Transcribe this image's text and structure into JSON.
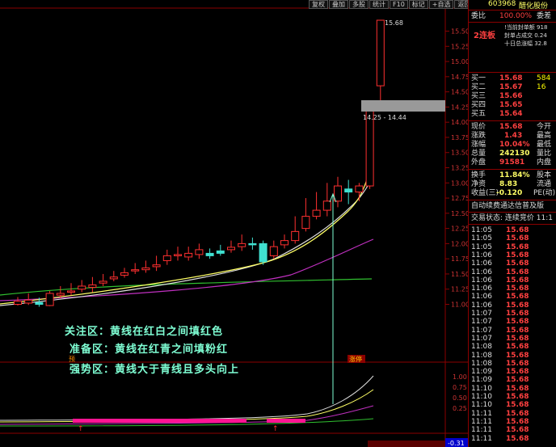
{
  "toolbar": [
    "复权",
    "叠加",
    "多股",
    "统计",
    "F10",
    "标记",
    "+自选",
    "返回"
  ],
  "stock": {
    "code": "603968",
    "name": "醋化股份"
  },
  "weibi": {
    "label": "委比",
    "value": "100.00%",
    "label2": "委差"
  },
  "lianban": "2连板",
  "limitup_info": [
    "!当前封单额 918",
    "封单占成交 0.24",
    "十日总涨幅 32.8"
  ],
  "bids": [
    {
      "label": "买一",
      "price": "15.68",
      "vol": "584"
    },
    {
      "label": "买二",
      "price": "15.67",
      "vol": "16"
    },
    {
      "label": "买三",
      "price": "15.66",
      "vol": ""
    },
    {
      "label": "买四",
      "price": "15.65",
      "vol": ""
    },
    {
      "label": "买五",
      "price": "15.64",
      "vol": ""
    }
  ],
  "quote": [
    {
      "l": "现价",
      "v": "15.68",
      "r": "今开"
    },
    {
      "l": "涨跌",
      "v": "1.43",
      "r": "最高"
    },
    {
      "l": "涨幅",
      "v": "10.04%",
      "r": "最低"
    },
    {
      "l": "总量",
      "v": "242130",
      "r": "量比"
    },
    {
      "l": "外盘",
      "v": "91581",
      "r": "内盘"
    }
  ],
  "fin": [
    {
      "l": "换手",
      "v": "11.84%",
      "r": "股本"
    },
    {
      "l": "净资",
      "v": "8.83",
      "r": "流通"
    },
    {
      "l": "收益(三)",
      "v": "-0.120",
      "r": "PE(动)"
    }
  ],
  "news": "自动续费通达信普及版",
  "trade_status": "交易状态: 连续竞价 11:1",
  "ticks": [
    {
      "t": "11:05",
      "p": "15.68"
    },
    {
      "t": "11:05",
      "p": "15.68"
    },
    {
      "t": "11:05",
      "p": "15.68"
    },
    {
      "t": "11:06",
      "p": "15.68"
    },
    {
      "t": "11:06",
      "p": "15.68"
    },
    {
      "t": "11:06",
      "p": "15.68"
    },
    {
      "t": "11:06",
      "p": "15.68"
    },
    {
      "t": "11:06",
      "p": "15.68"
    },
    {
      "t": "11:06",
      "p": "15.68"
    },
    {
      "t": "11:06",
      "p": "15.68"
    },
    {
      "t": "11:07",
      "p": "15.68"
    },
    {
      "t": "11:07",
      "p": "15.68"
    },
    {
      "t": "11:07",
      "p": "15.68"
    },
    {
      "t": "11:07",
      "p": "15.68"
    },
    {
      "t": "11:08",
      "p": "15.68"
    },
    {
      "t": "11:08",
      "p": "15.68"
    },
    {
      "t": "11:08",
      "p": "15.68"
    },
    {
      "t": "11:09",
      "p": "15.68"
    },
    {
      "t": "11:09",
      "p": "15.68"
    },
    {
      "t": "11:10",
      "p": "15.68"
    },
    {
      "t": "11:10",
      "p": "15.68"
    },
    {
      "t": "11:10",
      "p": "15.68"
    },
    {
      "t": "11:11",
      "p": "15.68"
    },
    {
      "t": "11:11",
      "p": "15.68"
    },
    {
      "t": "11:11",
      "p": "15.68"
    },
    {
      "t": "11:11",
      "p": "15.68"
    }
  ],
  "chart_data": {
    "type": "candlestick",
    "price_ticks": [
      "15.50",
      "15.25",
      "15.00",
      "14.75",
      "14.50",
      "14.25",
      "14.00",
      "13.75",
      "13.50",
      "13.25",
      "13.00",
      "12.75",
      "12.50",
      "12.25",
      "12.00",
      "11.75",
      "11.50",
      "11.25",
      "11.00"
    ],
    "ylim": [
      10.9,
      15.72
    ],
    "high_label": "15.68",
    "range_label": "14.25 - 14.44",
    "candles": [
      {
        "o": 11.0,
        "c": 11.05,
        "h": 11.12,
        "l": 10.98
      },
      {
        "o": 11.02,
        "c": 11.07,
        "h": 11.18,
        "l": 10.99
      },
      {
        "o": 11.03,
        "c": 11.0,
        "h": 11.11,
        "l": 10.96
      },
      {
        "o": 10.98,
        "c": 11.18,
        "h": 11.22,
        "l": 10.97
      },
      {
        "o": 11.15,
        "c": 11.18,
        "h": 11.3,
        "l": 11.1
      },
      {
        "o": 11.2,
        "c": 11.22,
        "h": 11.35,
        "l": 11.15
      },
      {
        "o": 11.25,
        "c": 11.3,
        "h": 11.4,
        "l": 11.2
      },
      {
        "o": 11.28,
        "c": 11.32,
        "h": 11.45,
        "l": 11.2
      },
      {
        "o": 11.35,
        "c": 11.38,
        "h": 11.5,
        "l": 11.3
      },
      {
        "o": 11.42,
        "c": 11.45,
        "h": 11.55,
        "l": 11.38
      },
      {
        "o": 11.48,
        "c": 11.52,
        "h": 11.6,
        "l": 11.44
      },
      {
        "o": 11.55,
        "c": 11.57,
        "h": 11.68,
        "l": 11.5
      },
      {
        "o": 11.57,
        "c": 11.6,
        "h": 11.72,
        "l": 11.52
      },
      {
        "o": 11.62,
        "c": 11.65,
        "h": 11.8,
        "l": 11.55
      },
      {
        "o": 11.72,
        "c": 11.8,
        "h": 11.9,
        "l": 11.65
      },
      {
        "o": 11.8,
        "c": 11.82,
        "h": 11.95,
        "l": 11.72
      },
      {
        "o": 11.78,
        "c": 11.84,
        "h": 11.95,
        "l": 11.72
      },
      {
        "o": 11.82,
        "c": 11.9,
        "h": 12.0,
        "l": 11.75
      },
      {
        "o": 11.84,
        "c": 11.8,
        "h": 11.92,
        "l": 11.75
      },
      {
        "o": 11.88,
        "c": 11.84,
        "h": 11.98,
        "l": 11.8
      },
      {
        "o": 11.9,
        "c": 11.94,
        "h": 12.05,
        "l": 11.85
      },
      {
        "o": 11.95,
        "c": 12.0,
        "h": 12.15,
        "l": 11.88
      },
      {
        "o": 12.0,
        "c": 11.98,
        "h": 12.1,
        "l": 11.9
      },
      {
        "o": 12.0,
        "c": 11.7,
        "h": 12.05,
        "l": 11.65
      },
      {
        "o": 11.8,
        "c": 11.95,
        "h": 12.05,
        "l": 11.75
      },
      {
        "o": 11.98,
        "c": 12.05,
        "h": 12.15,
        "l": 11.92
      },
      {
        "o": 12.05,
        "c": 12.2,
        "h": 12.45,
        "l": 12.0
      },
      {
        "o": 12.25,
        "c": 12.45,
        "h": 12.75,
        "l": 12.2
      },
      {
        "o": 12.45,
        "c": 12.55,
        "h": 12.85,
        "l": 12.4
      },
      {
        "o": 12.55,
        "c": 12.7,
        "h": 13.0,
        "l": 12.45
      },
      {
        "o": 12.7,
        "c": 12.95,
        "h": 13.1,
        "l": 12.6
      },
      {
        "o": 12.9,
        "c": 12.85,
        "h": 13.05,
        "l": 12.65
      },
      {
        "o": 12.85,
        "c": 12.95,
        "h": 13.0,
        "l": 12.7
      },
      {
        "o": 12.95,
        "c": 14.25,
        "h": 14.25,
        "l": 12.9
      },
      {
        "o": 14.6,
        "c": 15.68,
        "h": 15.68,
        "l": 14.3
      }
    ],
    "volume_ticks": [
      "1.00",
      "0.75",
      "0.50",
      "0.25"
    ],
    "volume_bottom_label": "-0.31",
    "marker_yu": "预",
    "marker_zt": "涨停"
  },
  "annotations": [
    "关注区：黄线在红白之间填红色",
    "准备区：黄线在红青之间填粉红",
    "强势区：黄线大于青线且多头向上"
  ]
}
